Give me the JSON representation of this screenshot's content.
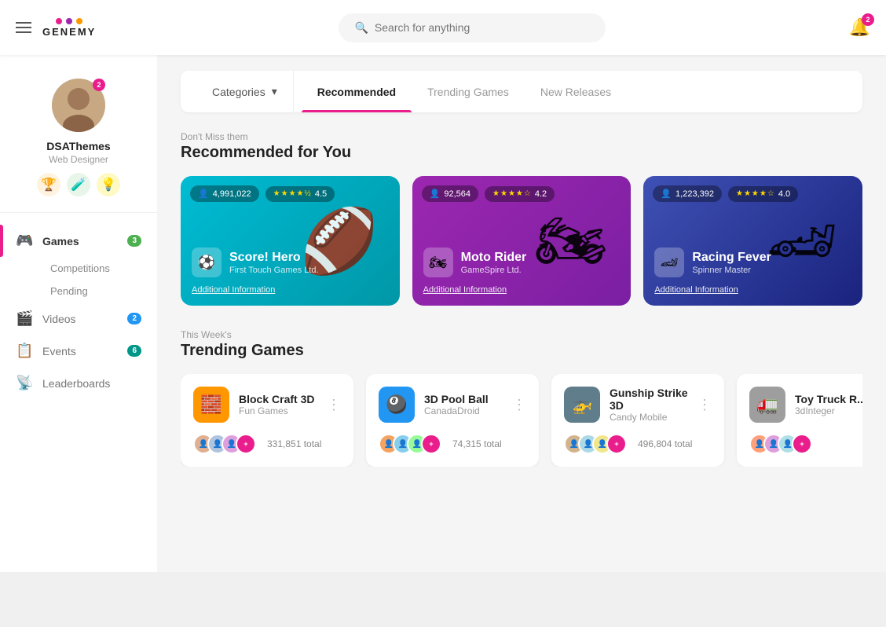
{
  "header": {
    "menu_icon": "☰",
    "logo_text": "GENEMY",
    "logo_dots": [
      "#e91e8c",
      "#9c27b0",
      "#ff9800"
    ],
    "search_placeholder": "Search for anything",
    "notif_count": "2"
  },
  "sidebar": {
    "user": {
      "name": "DSAThemes",
      "role": "Web Designer",
      "avatar_badge": "2",
      "badges": [
        "🏆",
        "🧪",
        "💡"
      ]
    },
    "nav": [
      {
        "id": "games",
        "icon": "🎮",
        "label": "Games",
        "badge": "3",
        "badge_color": "green",
        "active": true
      },
      {
        "id": "videos",
        "icon": "🎬",
        "label": "Videos",
        "badge": "2",
        "badge_color": "blue"
      },
      {
        "id": "events",
        "icon": "📋",
        "label": "Events",
        "badge": "6",
        "badge_color": "teal"
      },
      {
        "id": "leaderboards",
        "icon": "📡",
        "label": "Leaderboards"
      }
    ],
    "sub_nav": [
      {
        "label": "Competitions"
      },
      {
        "label": "Pending"
      }
    ]
  },
  "main": {
    "tabs": [
      {
        "id": "categories",
        "label": "Categories",
        "active": false,
        "has_dropdown": true
      },
      {
        "id": "recommended",
        "label": "Recommended",
        "active": true
      },
      {
        "id": "trending",
        "label": "Trending Games",
        "active": false
      },
      {
        "id": "new_releases",
        "label": "New Releases",
        "active": false
      }
    ],
    "recommended_section": {
      "label": "Don't Miss them",
      "title": "Recommended for You",
      "cards": [
        {
          "id": 1,
          "users": "4,991,022",
          "rating": "4.5",
          "stars": "★★★★½",
          "name": "Score! Hero",
          "developer": "First Touch Games Ltd.",
          "link": "Additional Information",
          "color_class": "rec-card-1",
          "icon": "🏈"
        },
        {
          "id": 2,
          "users": "92,564",
          "rating": "4.2",
          "stars": "★★★★☆",
          "name": "Moto Rider",
          "developer": "GameSpire Ltd.",
          "link": "Additional Information",
          "color_class": "rec-card-2",
          "icon": "🏍"
        },
        {
          "id": 3,
          "users": "1,223,392",
          "rating": "4.0",
          "stars": "★★★★☆",
          "name": "Racing Fever",
          "developer": "Spinner Master",
          "link": "Additional Information",
          "color_class": "rec-card-3",
          "icon": "🏎"
        }
      ]
    },
    "trending_section": {
      "label": "This Week's",
      "title": "Trending Games",
      "cards": [
        {
          "id": 1,
          "name": "Block Craft 3D",
          "developer": "Fun Games",
          "total": "331,851 total",
          "icon": "🧱",
          "bg": "#ff9800"
        },
        {
          "id": 2,
          "name": "3D Pool Ball",
          "developer": "CanadaDroid",
          "total": "74,315 total",
          "icon": "🎱",
          "bg": "#2196f3"
        },
        {
          "id": 3,
          "name": "Gunship Strike 3D",
          "developer": "Candy Mobile",
          "total": "496,804 total",
          "icon": "🚁",
          "bg": "#607d8b"
        },
        {
          "id": 4,
          "name": "Toy Truck R...",
          "developer": "3dInteger",
          "total": "—",
          "icon": "🚛",
          "bg": "#9e9e9e"
        }
      ]
    }
  }
}
